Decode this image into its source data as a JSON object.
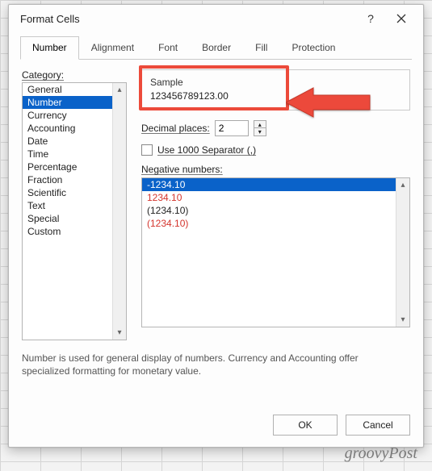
{
  "dialog": {
    "title": "Format Cells"
  },
  "tabs": [
    "Number",
    "Alignment",
    "Font",
    "Border",
    "Fill",
    "Protection"
  ],
  "category": {
    "label": "Category:",
    "items": [
      "General",
      "Number",
      "Currency",
      "Accounting",
      "Date",
      "Time",
      "Percentage",
      "Fraction",
      "Scientific",
      "Text",
      "Special",
      "Custom"
    ],
    "selected": "Number"
  },
  "sample": {
    "label": "Sample",
    "value": "123456789123.00"
  },
  "decimal": {
    "label": "Decimal places:",
    "value": "2"
  },
  "separator": {
    "label": "Use 1000 Separator (,)",
    "checked": false
  },
  "negative": {
    "label": "Negative numbers:",
    "items": [
      {
        "text": "-1234.10",
        "style": "sel"
      },
      {
        "text": "1234.10",
        "style": "red"
      },
      {
        "text": "(1234.10)",
        "style": "plain"
      },
      {
        "text": "(1234.10)",
        "style": "red"
      }
    ]
  },
  "description": "Number is used for general display of numbers.  Currency and Accounting offer specialized formatting for monetary value.",
  "buttons": {
    "ok": "OK",
    "cancel": "Cancel"
  },
  "watermark": "groovyPost"
}
